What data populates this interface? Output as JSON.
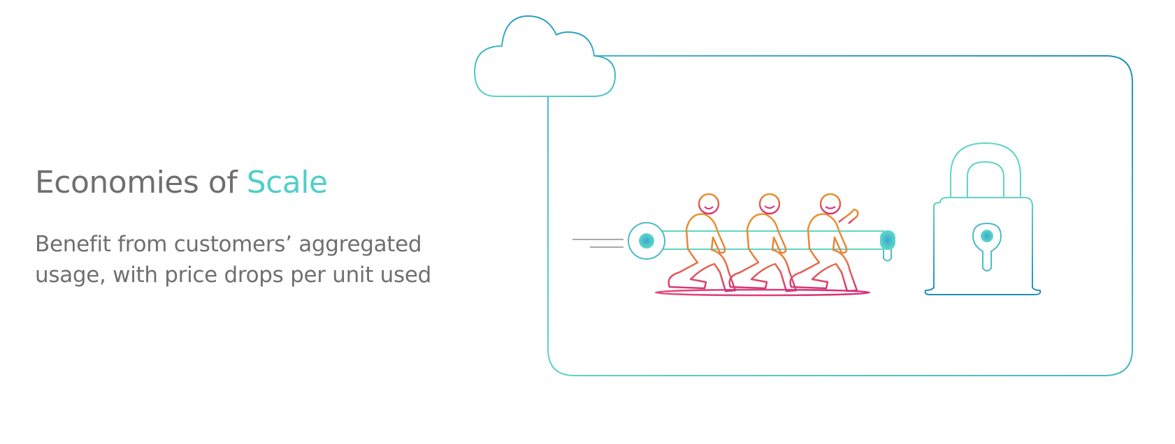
{
  "slide": {
    "title_prefix": "Economies of ",
    "title_accent": "Scale",
    "description": "Benefit from customers’ aggregated usage, with price drops per unit used"
  },
  "icons": {
    "cloud": "cloud-icon",
    "people": "people-pulling-log-icon",
    "lock": "padlock-icon"
  },
  "colors": {
    "heading_gray": "#6f6f6f",
    "accent_teal": "#4fcfc8",
    "frame_blue": "#1f8fb8",
    "people_orange": "#e8942a",
    "people_pink": "#d6307a"
  }
}
